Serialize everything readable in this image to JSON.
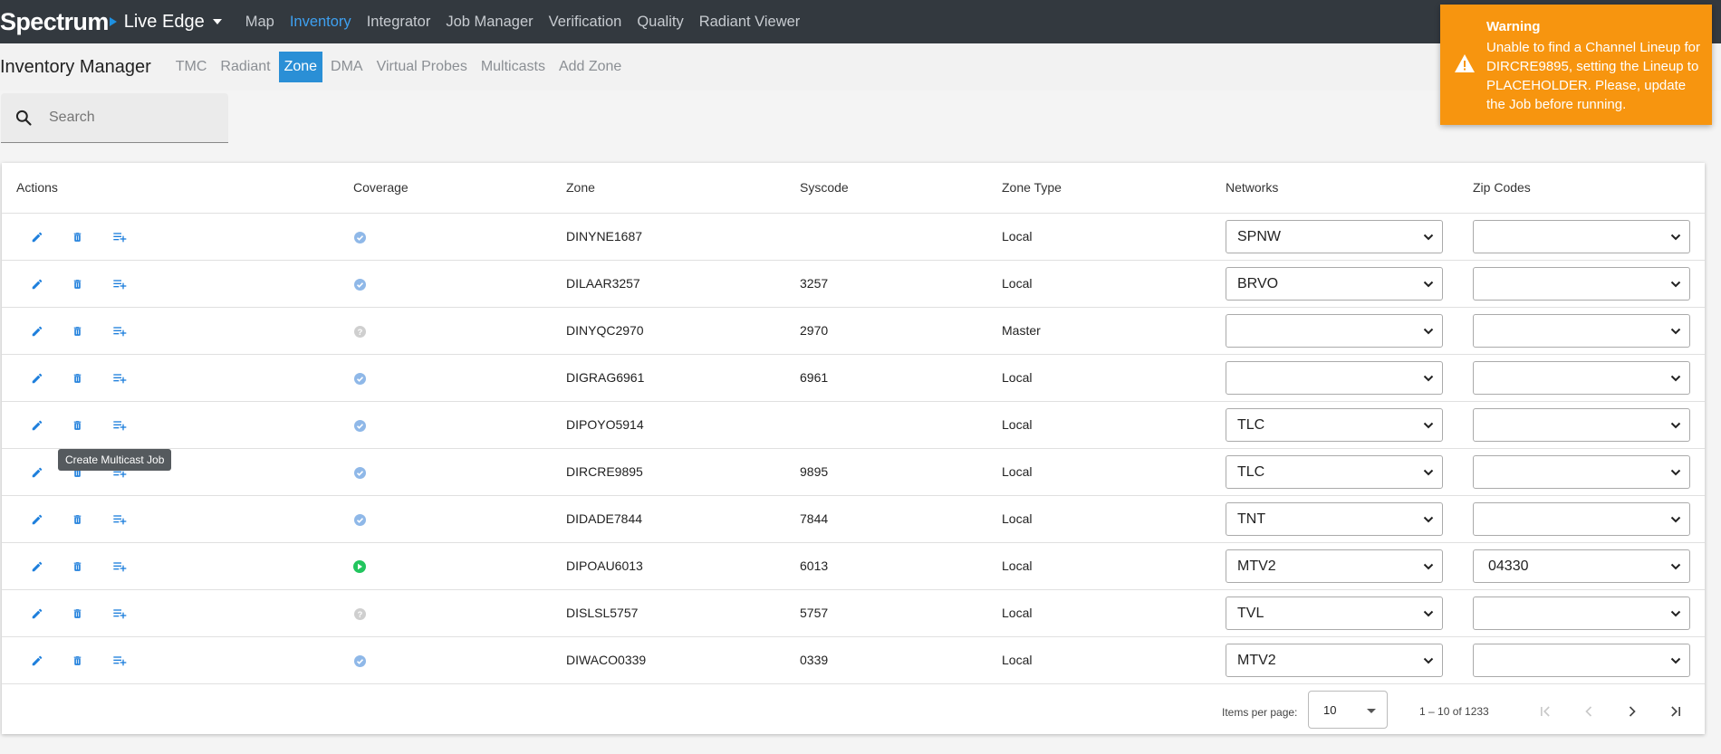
{
  "brand": {
    "logo": "Spectrum",
    "product": "Live Edge"
  },
  "topnav": [
    {
      "label": "Map",
      "active": false
    },
    {
      "label": "Inventory",
      "active": true
    },
    {
      "label": "Integrator",
      "active": false
    },
    {
      "label": "Job Manager",
      "active": false
    },
    {
      "label": "Verification",
      "active": false
    },
    {
      "label": "Quality",
      "active": false
    },
    {
      "label": "Radiant Viewer",
      "active": false
    }
  ],
  "subnav": {
    "title": "Inventory Manager",
    "tabs": [
      {
        "label": "TMC",
        "active": false
      },
      {
        "label": "Radiant",
        "active": false
      },
      {
        "label": "Zone",
        "active": true
      },
      {
        "label": "DMA",
        "active": false
      },
      {
        "label": "Virtual Probes",
        "active": false
      },
      {
        "label": "Multicasts",
        "active": false
      },
      {
        "label": "Add Zone",
        "active": false
      }
    ]
  },
  "search": {
    "placeholder": "Search",
    "value": ""
  },
  "table": {
    "headers": {
      "actions": "Actions",
      "coverage": "Coverage",
      "zone": "Zone",
      "syscode": "Syscode",
      "zone_type": "Zone Type",
      "networks": "Networks",
      "zip_codes": "Zip Codes"
    },
    "rows": [
      {
        "coverage": "verified",
        "zone": "DINYNE1687",
        "syscode": "",
        "zone_type": "Local",
        "network": "SPNW",
        "zip": ""
      },
      {
        "coverage": "verified",
        "zone": "DILAAR3257",
        "syscode": "3257",
        "zone_type": "Local",
        "network": "BRVO",
        "zip": ""
      },
      {
        "coverage": "unknown",
        "zone": "DINYQC2970",
        "syscode": "2970",
        "zone_type": "Master",
        "network": "",
        "zip": ""
      },
      {
        "coverage": "verified",
        "zone": "DIGRAG6961",
        "syscode": "6961",
        "zone_type": "Local",
        "network": "",
        "zip": ""
      },
      {
        "coverage": "verified",
        "zone": "DIPOYO5914",
        "syscode": "",
        "zone_type": "Local",
        "network": "TLC",
        "zip": ""
      },
      {
        "coverage": "verified",
        "zone": "DIRCRE9895",
        "syscode": "9895",
        "zone_type": "Local",
        "network": "TLC",
        "zip": ""
      },
      {
        "coverage": "verified",
        "zone": "DIDADE7844",
        "syscode": "7844",
        "zone_type": "Local",
        "network": "TNT",
        "zip": ""
      },
      {
        "coverage": "playing",
        "zone": "DIPOAU6013",
        "syscode": "6013",
        "zone_type": "Local",
        "network": "MTV2",
        "zip": "04330"
      },
      {
        "coverage": "unknown",
        "zone": "DISLSL5757",
        "syscode": "5757",
        "zone_type": "Local",
        "network": "TVL",
        "zip": ""
      },
      {
        "coverage": "verified",
        "zone": "DIWACO0339",
        "syscode": "0339",
        "zone_type": "Local",
        "network": "MTV2",
        "zip": ""
      }
    ]
  },
  "tooltip": {
    "text": "Create Multicast Job"
  },
  "paginator": {
    "items_per_page_label": "Items per page:",
    "items_per_page": "10",
    "range": "1 – 10 of 1233"
  },
  "toast": {
    "title": "Warning",
    "message": "Unable to find a Channel Lineup for DIRCRE9895, setting the Lineup to PLACEHOLDER. Please, update the Job before running."
  },
  "colors": {
    "topbar": "#33393f",
    "accent": "#2a8fd6",
    "icon_blue": "#1e7fdc",
    "coverage_verified": "#8fb8e8",
    "coverage_unknown": "#cfcfcf",
    "coverage_playing": "#22c55e",
    "warning": "#f7950f"
  }
}
